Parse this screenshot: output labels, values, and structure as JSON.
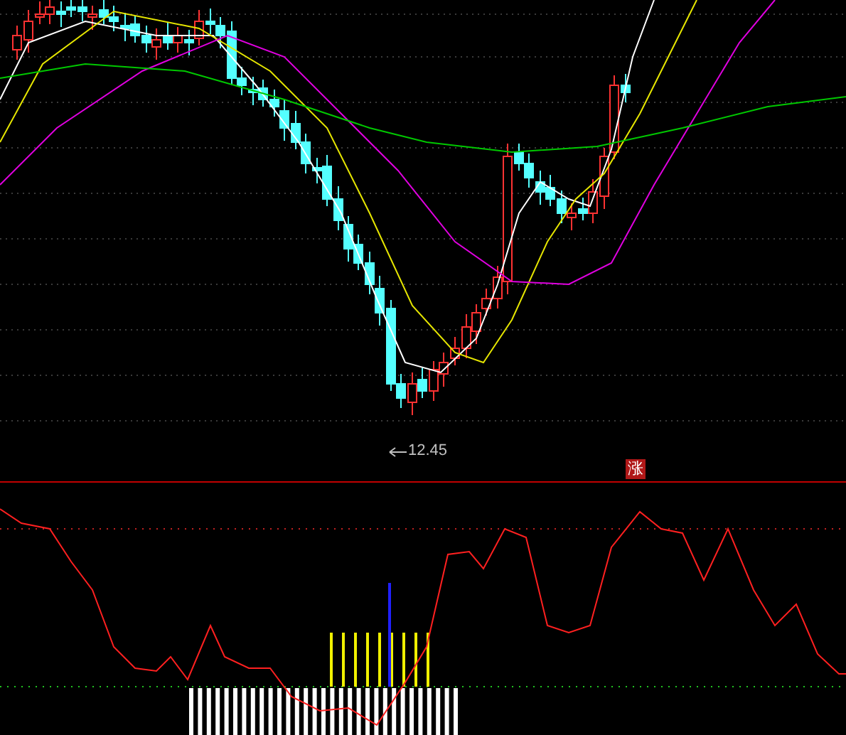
{
  "price_chart": {
    "low_label": "12.45"
  },
  "badge": {
    "text": "涨"
  }
}
